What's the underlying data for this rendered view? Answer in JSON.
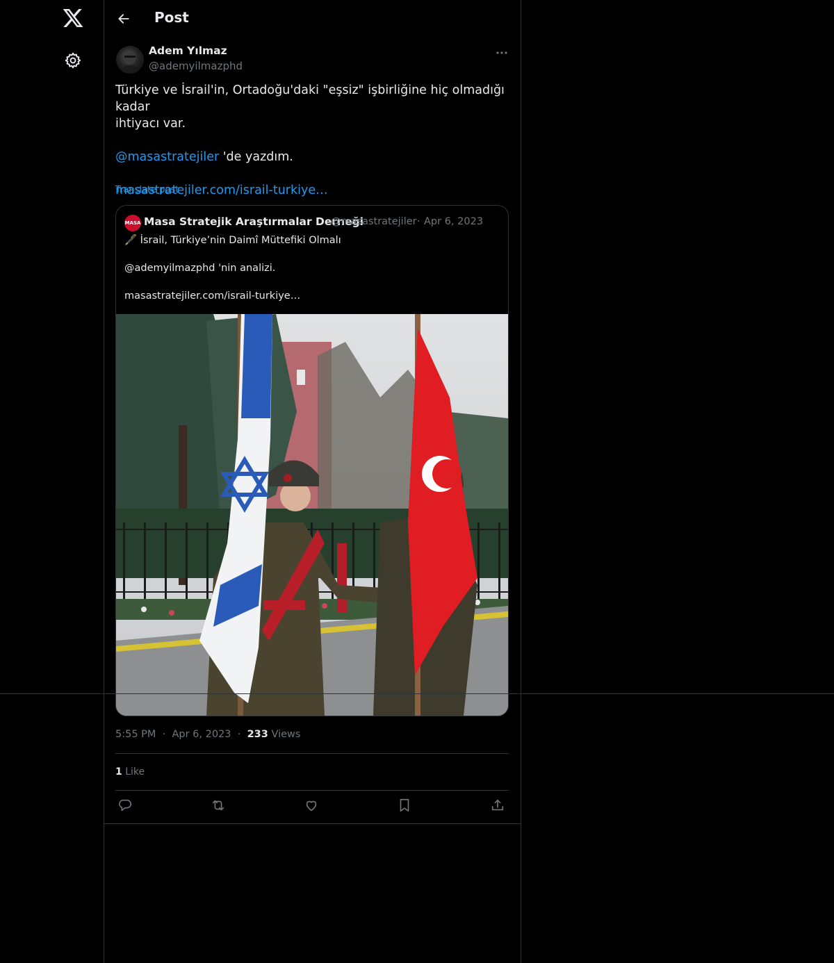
{
  "nav": {
    "logo_icon": "x-logo-icon",
    "settings_icon": "gear-icon"
  },
  "header": {
    "title": "Post",
    "back_icon": "back-arrow-icon"
  },
  "post": {
    "author_name": "Adem Yılmaz",
    "author_handle": "@ademyilmazphd",
    "text_line1": "Türkiye ve İsrail'in, Ortadoğu'daki \"eşsiz\" işbirliğine hiç olmadığı kadar",
    "text_line2": "ihtiyacı var.",
    "mention": "@masastratejiler",
    "mention_suffix": " 'de yazdım.",
    "link": "masastratejiler.com/israil-turkiye…",
    "translate": "Translate post",
    "time": "5:55 PM",
    "date": "Apr 6, 2023",
    "views_count": "233",
    "views_label": "Views",
    "likes_count": "1",
    "likes_label": "Like"
  },
  "quote": {
    "avatar_text": "MASA",
    "name": "Masa Stratejik Araştırmalar Derneği",
    "handle": "@masastratejiler",
    "date": "Apr 6, 2023",
    "line1": "🖋️ İsrail, Türkiye’nin Daimî Müttefiki Olmalı",
    "line2": "@ademyilmazphd 'nin analizi.",
    "line3": "masastratejiler.com/israil-turkiye…"
  },
  "colors": {
    "accent": "#1d9bf0",
    "muted": "#71767b",
    "border": "#2f3336"
  }
}
